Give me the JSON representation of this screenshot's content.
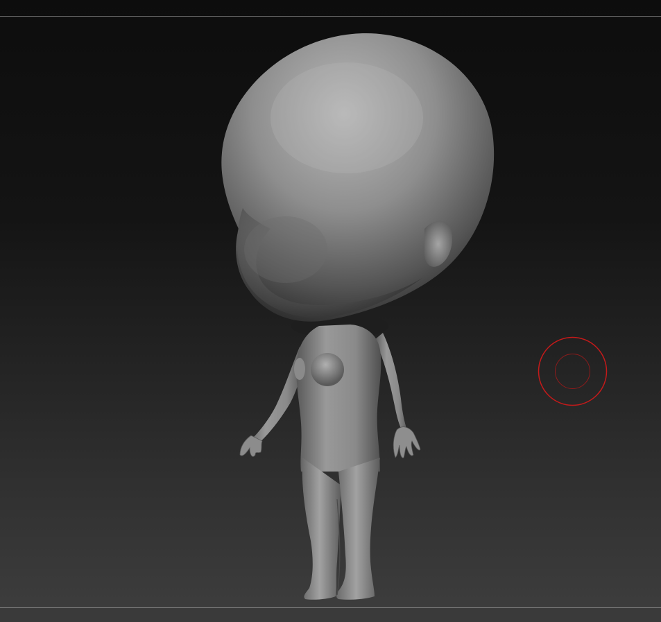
{
  "viewport": {
    "background_top": "#0d0d0d",
    "background_bottom": "#3e3e3e",
    "model": {
      "name": "chibi-figure",
      "material_color": "#8f8f8f"
    },
    "brush": {
      "outer_color": "#c41a1a",
      "inner_color": "#8e1b1b"
    }
  }
}
